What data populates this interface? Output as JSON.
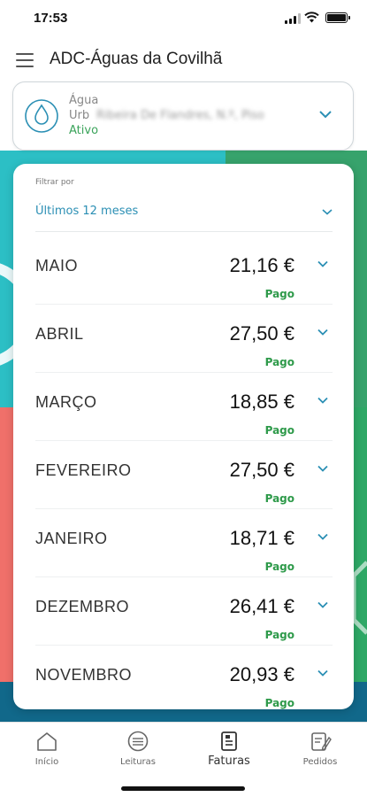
{
  "status_bar": {
    "time": "17:53"
  },
  "header": {
    "title": "ADC-Águas da Covilhã"
  },
  "account": {
    "type": "Água",
    "address_label": "Urb",
    "address": "Ribeira De Flandres, N.º, Piso",
    "status": "Ativo"
  },
  "filter": {
    "label": "Filtrar por",
    "value": "Últimos 12 meses"
  },
  "invoices": [
    {
      "month": "MAIO",
      "amount": "21,16 €",
      "status": "Pago"
    },
    {
      "month": "ABRIL",
      "amount": "27,50 €",
      "status": "Pago"
    },
    {
      "month": "MARÇO",
      "amount": "18,85 €",
      "status": "Pago"
    },
    {
      "month": "FEVEREIRO",
      "amount": "27,50 €",
      "status": "Pago"
    },
    {
      "month": "JANEIRO",
      "amount": "18,71 €",
      "status": "Pago"
    },
    {
      "month": "DEZEMBRO",
      "amount": "26,41 €",
      "status": "Pago"
    },
    {
      "month": "NOVEMBRO",
      "amount": "20,93 €",
      "status": "Pago"
    }
  ],
  "nav": {
    "items": [
      {
        "label": "Início",
        "icon": "home-icon"
      },
      {
        "label": "Leituras",
        "icon": "meter-icon"
      },
      {
        "label": "Faturas",
        "icon": "invoice-icon"
      },
      {
        "label": "Pedidos",
        "icon": "request-icon"
      }
    ],
    "active": "Faturas"
  },
  "colors": {
    "accent": "#2b8fb4",
    "paid": "#2e9a4a",
    "active_status": "#3aa35a"
  }
}
